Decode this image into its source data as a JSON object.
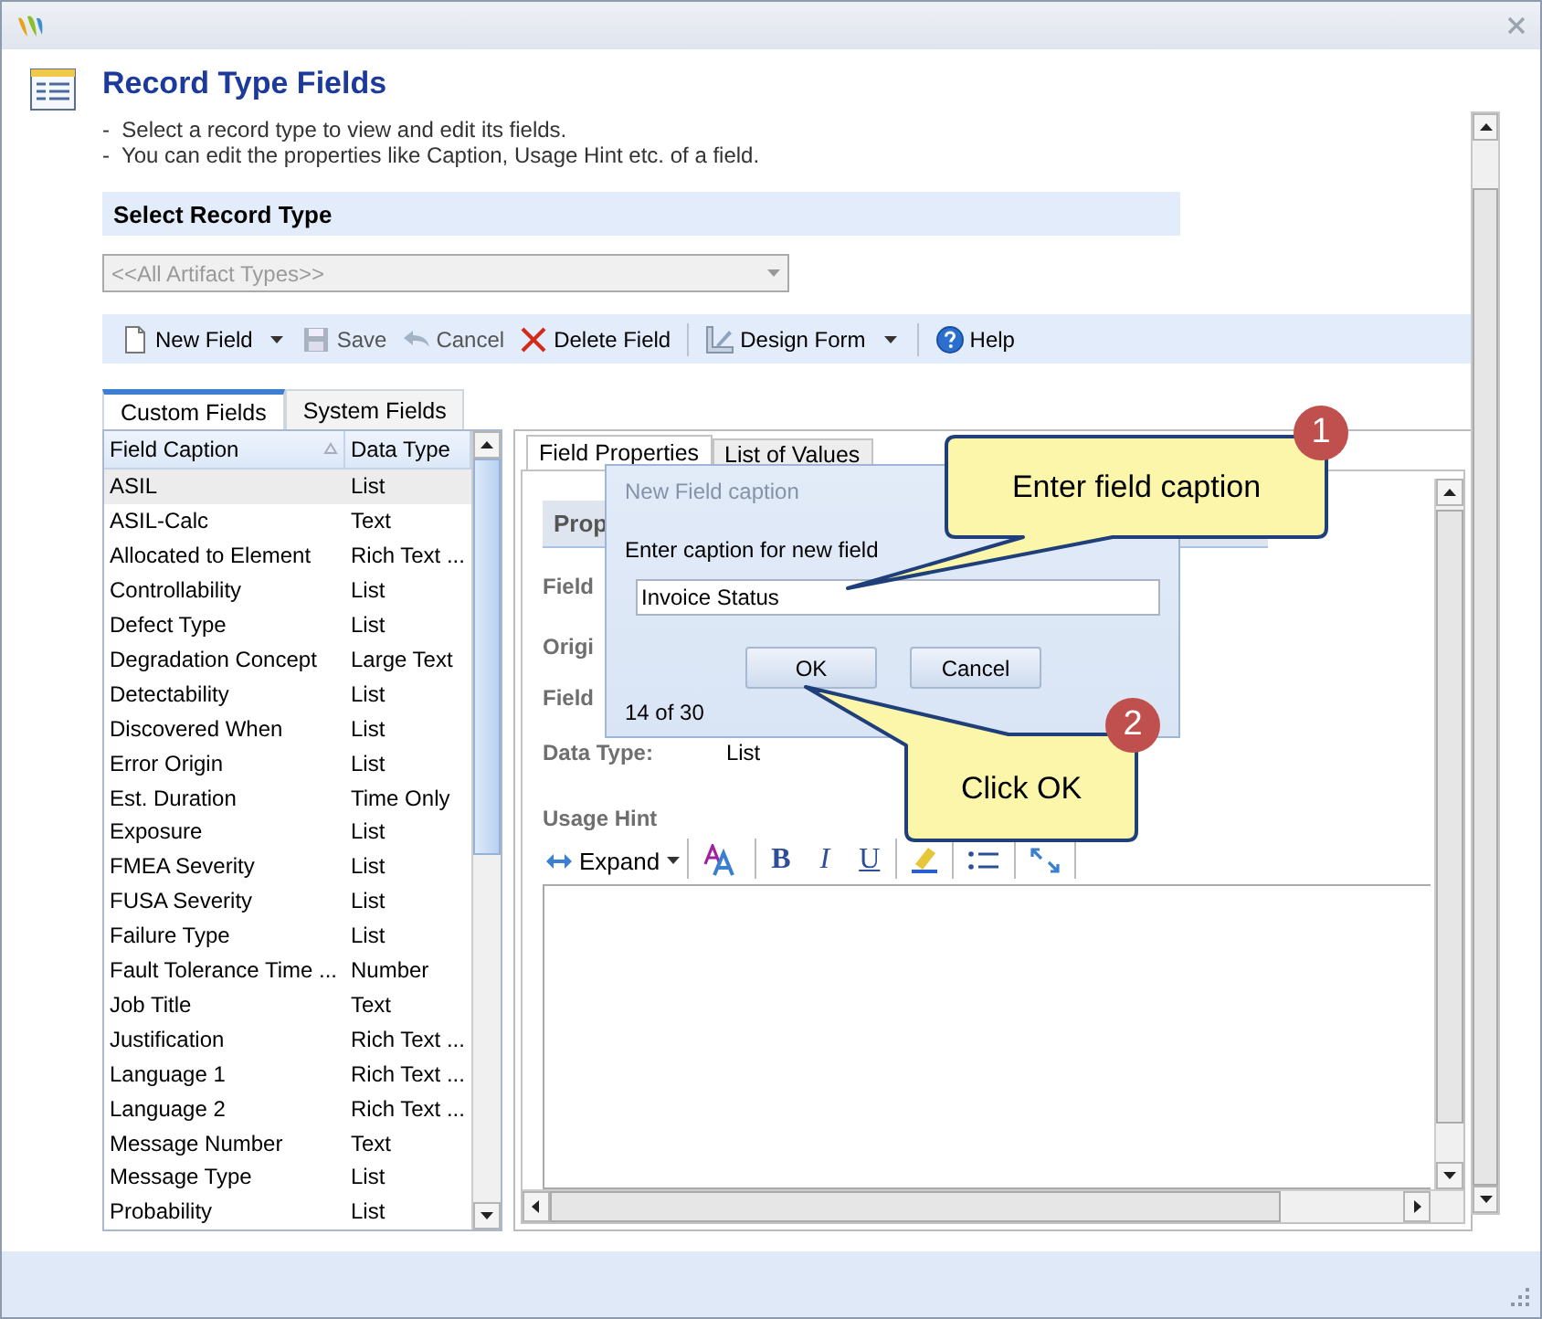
{
  "header": {
    "title": "Record Type Fields",
    "instructions": [
      "-  Select a record type to view and edit its fields.",
      "-  You can edit the properties like Caption, Usage Hint etc. of a field."
    ]
  },
  "record_type": {
    "heading": "Select Record Type",
    "value": "<<All Artifact Types>>",
    "disabled": true
  },
  "toolbar": [
    {
      "kind": "new",
      "label": "New Field",
      "has_menu": true,
      "disabled": false
    },
    {
      "kind": "save",
      "label": "Save",
      "has_menu": false,
      "disabled": true
    },
    {
      "kind": "cancel",
      "label": "Cancel",
      "has_menu": false,
      "disabled": true
    },
    {
      "kind": "delete",
      "label": "Delete Field",
      "has_menu": false,
      "disabled": false
    },
    {
      "kind": "design",
      "label": "Design Form",
      "has_menu": true,
      "disabled": false
    },
    {
      "kind": "help",
      "label": "Help",
      "has_menu": false,
      "disabled": false
    }
  ],
  "field_tabs": [
    {
      "label": "Custom Fields",
      "selected": true
    },
    {
      "label": "System Fields",
      "selected": false
    }
  ],
  "fields_grid": {
    "columns": [
      {
        "label": "Field Caption",
        "sorted": true
      },
      {
        "label": "Data Type",
        "sorted": false
      }
    ],
    "rows": [
      {
        "caption": "ASIL",
        "type": "List",
        "selected": true
      },
      {
        "caption": "ASIL-Calc",
        "type": "Text",
        "selected": false
      },
      {
        "caption": "Allocated to Element",
        "type": "Rich Text ...",
        "selected": false
      },
      {
        "caption": "Controllability",
        "type": "List",
        "selected": false
      },
      {
        "caption": "Defect Type",
        "type": "List",
        "selected": false
      },
      {
        "caption": "Degradation Concept",
        "type": "Large Text",
        "selected": false
      },
      {
        "caption": "Detectability",
        "type": "List",
        "selected": false
      },
      {
        "caption": "Discovered When",
        "type": "List",
        "selected": false
      },
      {
        "caption": "Error Origin",
        "type": "List",
        "selected": false
      },
      {
        "caption": "Est. Duration",
        "type": "Time Only",
        "selected": false
      },
      {
        "caption": "Exposure",
        "type": "List",
        "selected": false
      },
      {
        "caption": "FMEA Severity",
        "type": "List",
        "selected": false
      },
      {
        "caption": "FUSA Severity",
        "type": "List",
        "selected": false
      },
      {
        "caption": "Failure Type",
        "type": "List",
        "selected": false
      },
      {
        "caption": "Fault Tolerance Time ...",
        "type": "Number",
        "selected": false
      },
      {
        "caption": "Job Title",
        "type": "Text",
        "selected": false
      },
      {
        "caption": "Justification",
        "type": "Rich Text ...",
        "selected": false
      },
      {
        "caption": "Language 1",
        "type": "Rich Text ...",
        "selected": false
      },
      {
        "caption": "Language 2",
        "type": "Rich Text ...",
        "selected": false
      },
      {
        "caption": "Message Number",
        "type": "Text",
        "selected": false
      },
      {
        "caption": "Message Type",
        "type": "List",
        "selected": false
      },
      {
        "caption": "Probability",
        "type": "List",
        "selected": false
      }
    ]
  },
  "detail": {
    "tabs": [
      {
        "label": "Field Properties",
        "selected": true
      },
      {
        "label": "List of Values",
        "selected": false
      }
    ],
    "section_title": "Prop",
    "labels": [
      "Field",
      "Origi",
      "Field"
    ],
    "data_type": {
      "label": "Data Type:",
      "value": "List"
    },
    "usage_hint": {
      "label": "Usage Hint",
      "toolbar": [
        {
          "kind": "expand",
          "label": "Expand"
        },
        {
          "kind": "font-color"
        },
        {
          "kind": "bold",
          "label": "B"
        },
        {
          "kind": "italic",
          "label": "I"
        },
        {
          "kind": "underline",
          "label": "U"
        },
        {
          "kind": "highlight"
        },
        {
          "kind": "list"
        },
        {
          "kind": "fullscreen"
        }
      ]
    }
  },
  "dialog": {
    "title": "New Field caption",
    "prompt": "Enter caption for new field",
    "value": "Invoice Status",
    "buttons": [
      "OK",
      "Cancel"
    ],
    "counter": "14 of 30"
  },
  "callouts": [
    {
      "number": "1",
      "text": "Enter field caption"
    },
    {
      "number": "2",
      "text": "Click OK"
    }
  ]
}
